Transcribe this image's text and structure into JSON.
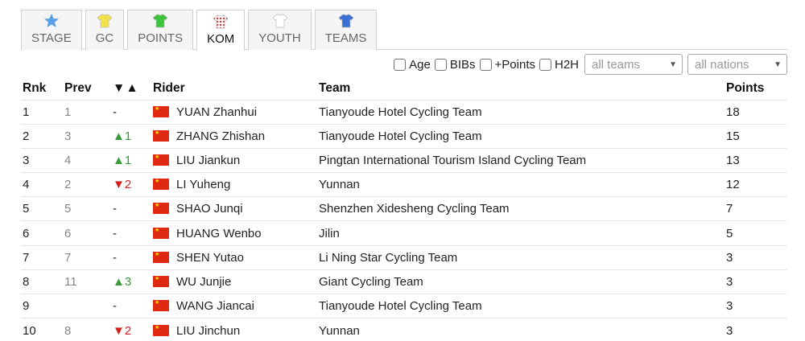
{
  "tabs": [
    {
      "label": "STAGE",
      "icon": "star-icon",
      "color": "#5aa0e6"
    },
    {
      "label": "GC",
      "icon": "jersey-yellow-icon",
      "color": "#f2e24a"
    },
    {
      "label": "POINTS",
      "icon": "jersey-green-icon",
      "color": "#3cc43c"
    },
    {
      "label": "KOM",
      "icon": "jersey-polka-icon",
      "color": "#d33"
    },
    {
      "label": "YOUTH",
      "icon": "jersey-white-icon",
      "color": "#ffffff"
    },
    {
      "label": "TEAMS",
      "icon": "jersey-blue-icon",
      "color": "#3b6fd1"
    }
  ],
  "active_tab": "KOM",
  "filters": {
    "age_label": "Age",
    "bibs_label": "BIBs",
    "points_label": "+Points",
    "h2h_label": "H2H",
    "teams_select": "all teams",
    "nations_select": "all nations"
  },
  "table": {
    "headers": {
      "rnk": "Rnk",
      "prev": "Prev",
      "change": "▼▲",
      "rider": "Rider",
      "team": "Team",
      "points": "Points"
    },
    "rows": [
      {
        "rnk": "1",
        "prev": "1",
        "change": "-",
        "dir": "none",
        "rider": "YUAN Zhanhui",
        "team": "Tianyoude Hotel Cycling Team",
        "points": "18"
      },
      {
        "rnk": "2",
        "prev": "3",
        "change": "▲1",
        "dir": "up",
        "rider": "ZHANG Zhishan",
        "team": "Tianyoude Hotel Cycling Team",
        "points": "15"
      },
      {
        "rnk": "3",
        "prev": "4",
        "change": "▲1",
        "dir": "up",
        "rider": "LIU Jiankun",
        "team": "Pingtan International Tourism Island Cycling Team",
        "points": "13"
      },
      {
        "rnk": "4",
        "prev": "2",
        "change": "▼2",
        "dir": "down",
        "rider": "LI Yuheng",
        "team": "Yunnan",
        "points": "12"
      },
      {
        "rnk": "5",
        "prev": "5",
        "change": "-",
        "dir": "none",
        "rider": "SHAO Junqi",
        "team": "Shenzhen Xidesheng Cycling Team",
        "points": "7"
      },
      {
        "rnk": "6",
        "prev": "6",
        "change": "-",
        "dir": "none",
        "rider": "HUANG Wenbo",
        "team": "Jilin",
        "points": "5"
      },
      {
        "rnk": "7",
        "prev": "7",
        "change": "-",
        "dir": "none",
        "rider": "SHEN Yutao",
        "team": "Li Ning Star Cycling Team",
        "points": "3"
      },
      {
        "rnk": "8",
        "prev": "11",
        "change": "▲3",
        "dir": "up",
        "rider": "WU Junjie",
        "team": "Giant Cycling Team",
        "points": "3"
      },
      {
        "rnk": "9",
        "prev": "",
        "change": "-",
        "dir": "none",
        "rider": "WANG Jiancai",
        "team": "Tianyoude Hotel Cycling Team",
        "points": "3"
      },
      {
        "rnk": "10",
        "prev": "8",
        "change": "▼2",
        "dir": "down",
        "rider": "LIU Jinchun",
        "team": "Yunnan",
        "points": "3"
      }
    ]
  },
  "colors": {
    "up": "#3a9a3a",
    "down": "#d62020",
    "flag": "#de2910"
  }
}
